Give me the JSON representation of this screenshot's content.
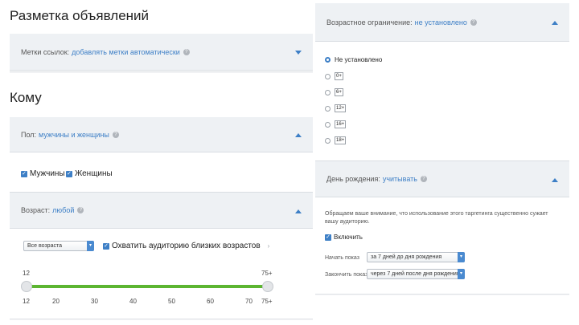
{
  "left": {
    "ad_markup_title": "Разметка объявлений",
    "link_tags": {
      "label": "Метки ссылок:",
      "value": "добавлять метки автоматически"
    },
    "audience_title": "Кому",
    "gender": {
      "label": "Пол:",
      "value": "мужчины и женщины",
      "options": [
        "Мужчины",
        "Женщины"
      ]
    },
    "age": {
      "label": "Возраст:",
      "value": "любой",
      "select_value": "Все возраста",
      "expand_label": "Охватить аудиторию близких возрастов",
      "slider_min_label": "12",
      "slider_max_label": "75+",
      "ticks": [
        "12",
        "20",
        "30",
        "40",
        "50",
        "60",
        "70",
        "75+"
      ],
      "range_from": "12",
      "range_to": "75+"
    }
  },
  "right": {
    "age_restriction": {
      "label": "Возрастное ограничение:",
      "value": "не установлено",
      "options": [
        "Не установлено",
        "0+",
        "6+",
        "12+",
        "16+",
        "18+"
      ],
      "selected": 0
    },
    "birthday": {
      "label": "День рождения:",
      "value": "учитывать",
      "note": "Обращаем ваше внимание, что использование этого таргетинга существенно сужает вашу аудиторию.",
      "enable_label": "Включить",
      "start_label": "Начать показ",
      "start_value": "за 7 дней до дня рождения",
      "end_label": "Закончить показ",
      "end_value": "через 7 дней после дня рождения"
    }
  }
}
